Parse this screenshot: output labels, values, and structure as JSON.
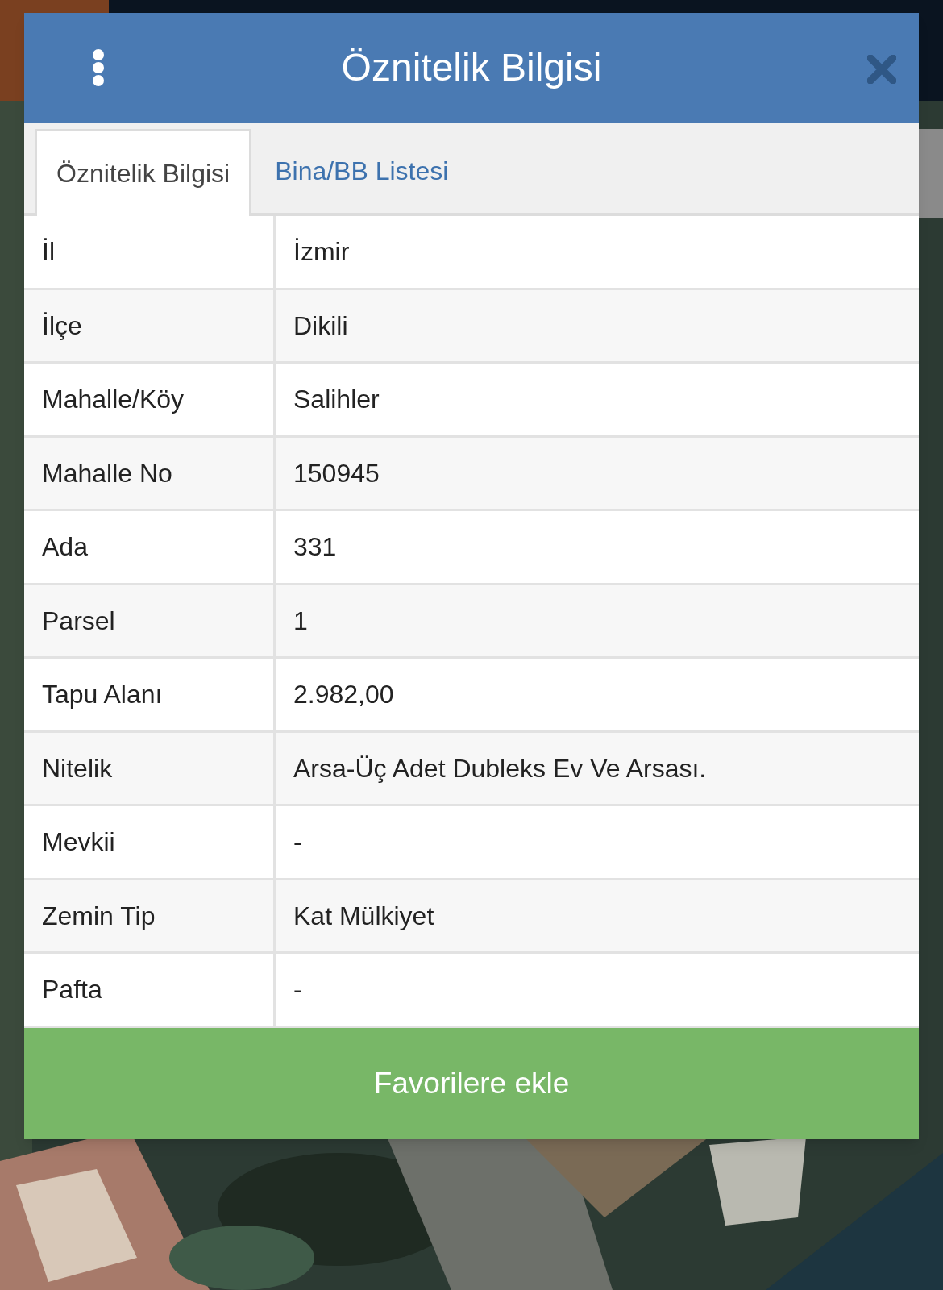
{
  "dialog": {
    "title": "Öznitelik Bilgisi"
  },
  "tabs": [
    {
      "label": "Öznitelik Bilgisi",
      "selected": true
    },
    {
      "label": "Bina/BB Listesi",
      "selected": false
    }
  ],
  "rows": [
    {
      "label": "İl",
      "value": "İzmir"
    },
    {
      "label": "İlçe",
      "value": "Dikili"
    },
    {
      "label": "Mahalle/Köy",
      "value": "Salihler"
    },
    {
      "label": "Mahalle No",
      "value": "150945"
    },
    {
      "label": "Ada",
      "value": "331"
    },
    {
      "label": "Parsel",
      "value": "1"
    },
    {
      "label": "Tapu Alanı",
      "value": "2.982,00"
    },
    {
      "label": "Nitelik",
      "value": "Arsa-Üç Adet Dubleks Ev Ve Arsası."
    },
    {
      "label": "Mevkii",
      "value": "-"
    },
    {
      "label": "Zemin Tip",
      "value": "Kat Mülkiyet"
    },
    {
      "label": "Pafta",
      "value": "-"
    }
  ],
  "button": {
    "label": "Favorilere ekle"
  }
}
